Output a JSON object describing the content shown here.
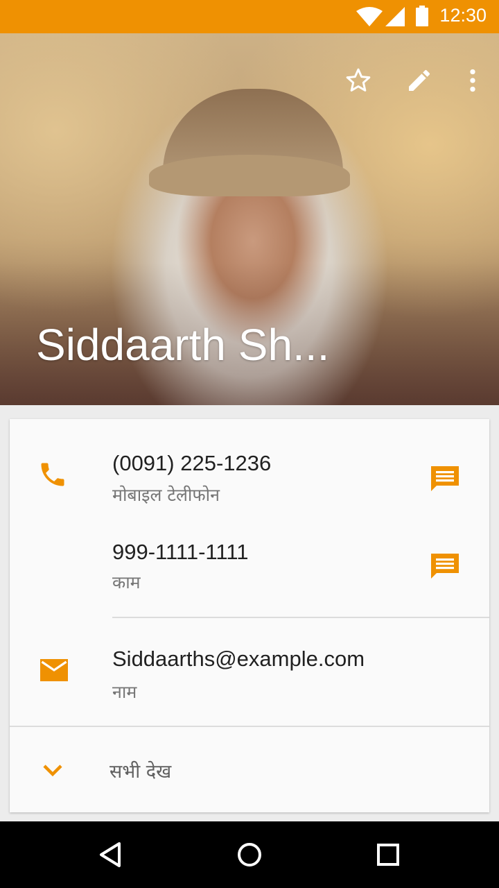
{
  "status_bar": {
    "time": "12:30",
    "icons": [
      "wifi-icon",
      "cellular-signal-icon",
      "battery-icon"
    ],
    "background": "#ef9102"
  },
  "contact": {
    "name": "Siddaarth Sh..."
  },
  "hero_actions": {
    "icons": [
      "star-outline-icon",
      "edit-pencil-icon",
      "overflow-menu-icon"
    ]
  },
  "details": {
    "phones": [
      {
        "number": "(0091) 225-1236",
        "type": "मोबाइल टेलीफोन"
      },
      {
        "number": "999-1111-1111",
        "type": "काम"
      }
    ],
    "email": {
      "address": "Siddaarths@example.com",
      "type": "नाम"
    },
    "see_all": "सभी देख"
  },
  "colors": {
    "accent": "#ef9102",
    "primary_text": "#212121",
    "secondary_text": "#757575",
    "card_background": "#fafafa"
  },
  "nav_bar": {
    "icons": [
      "back-triangle-icon",
      "home-circle-icon",
      "recents-square-icon"
    ]
  }
}
